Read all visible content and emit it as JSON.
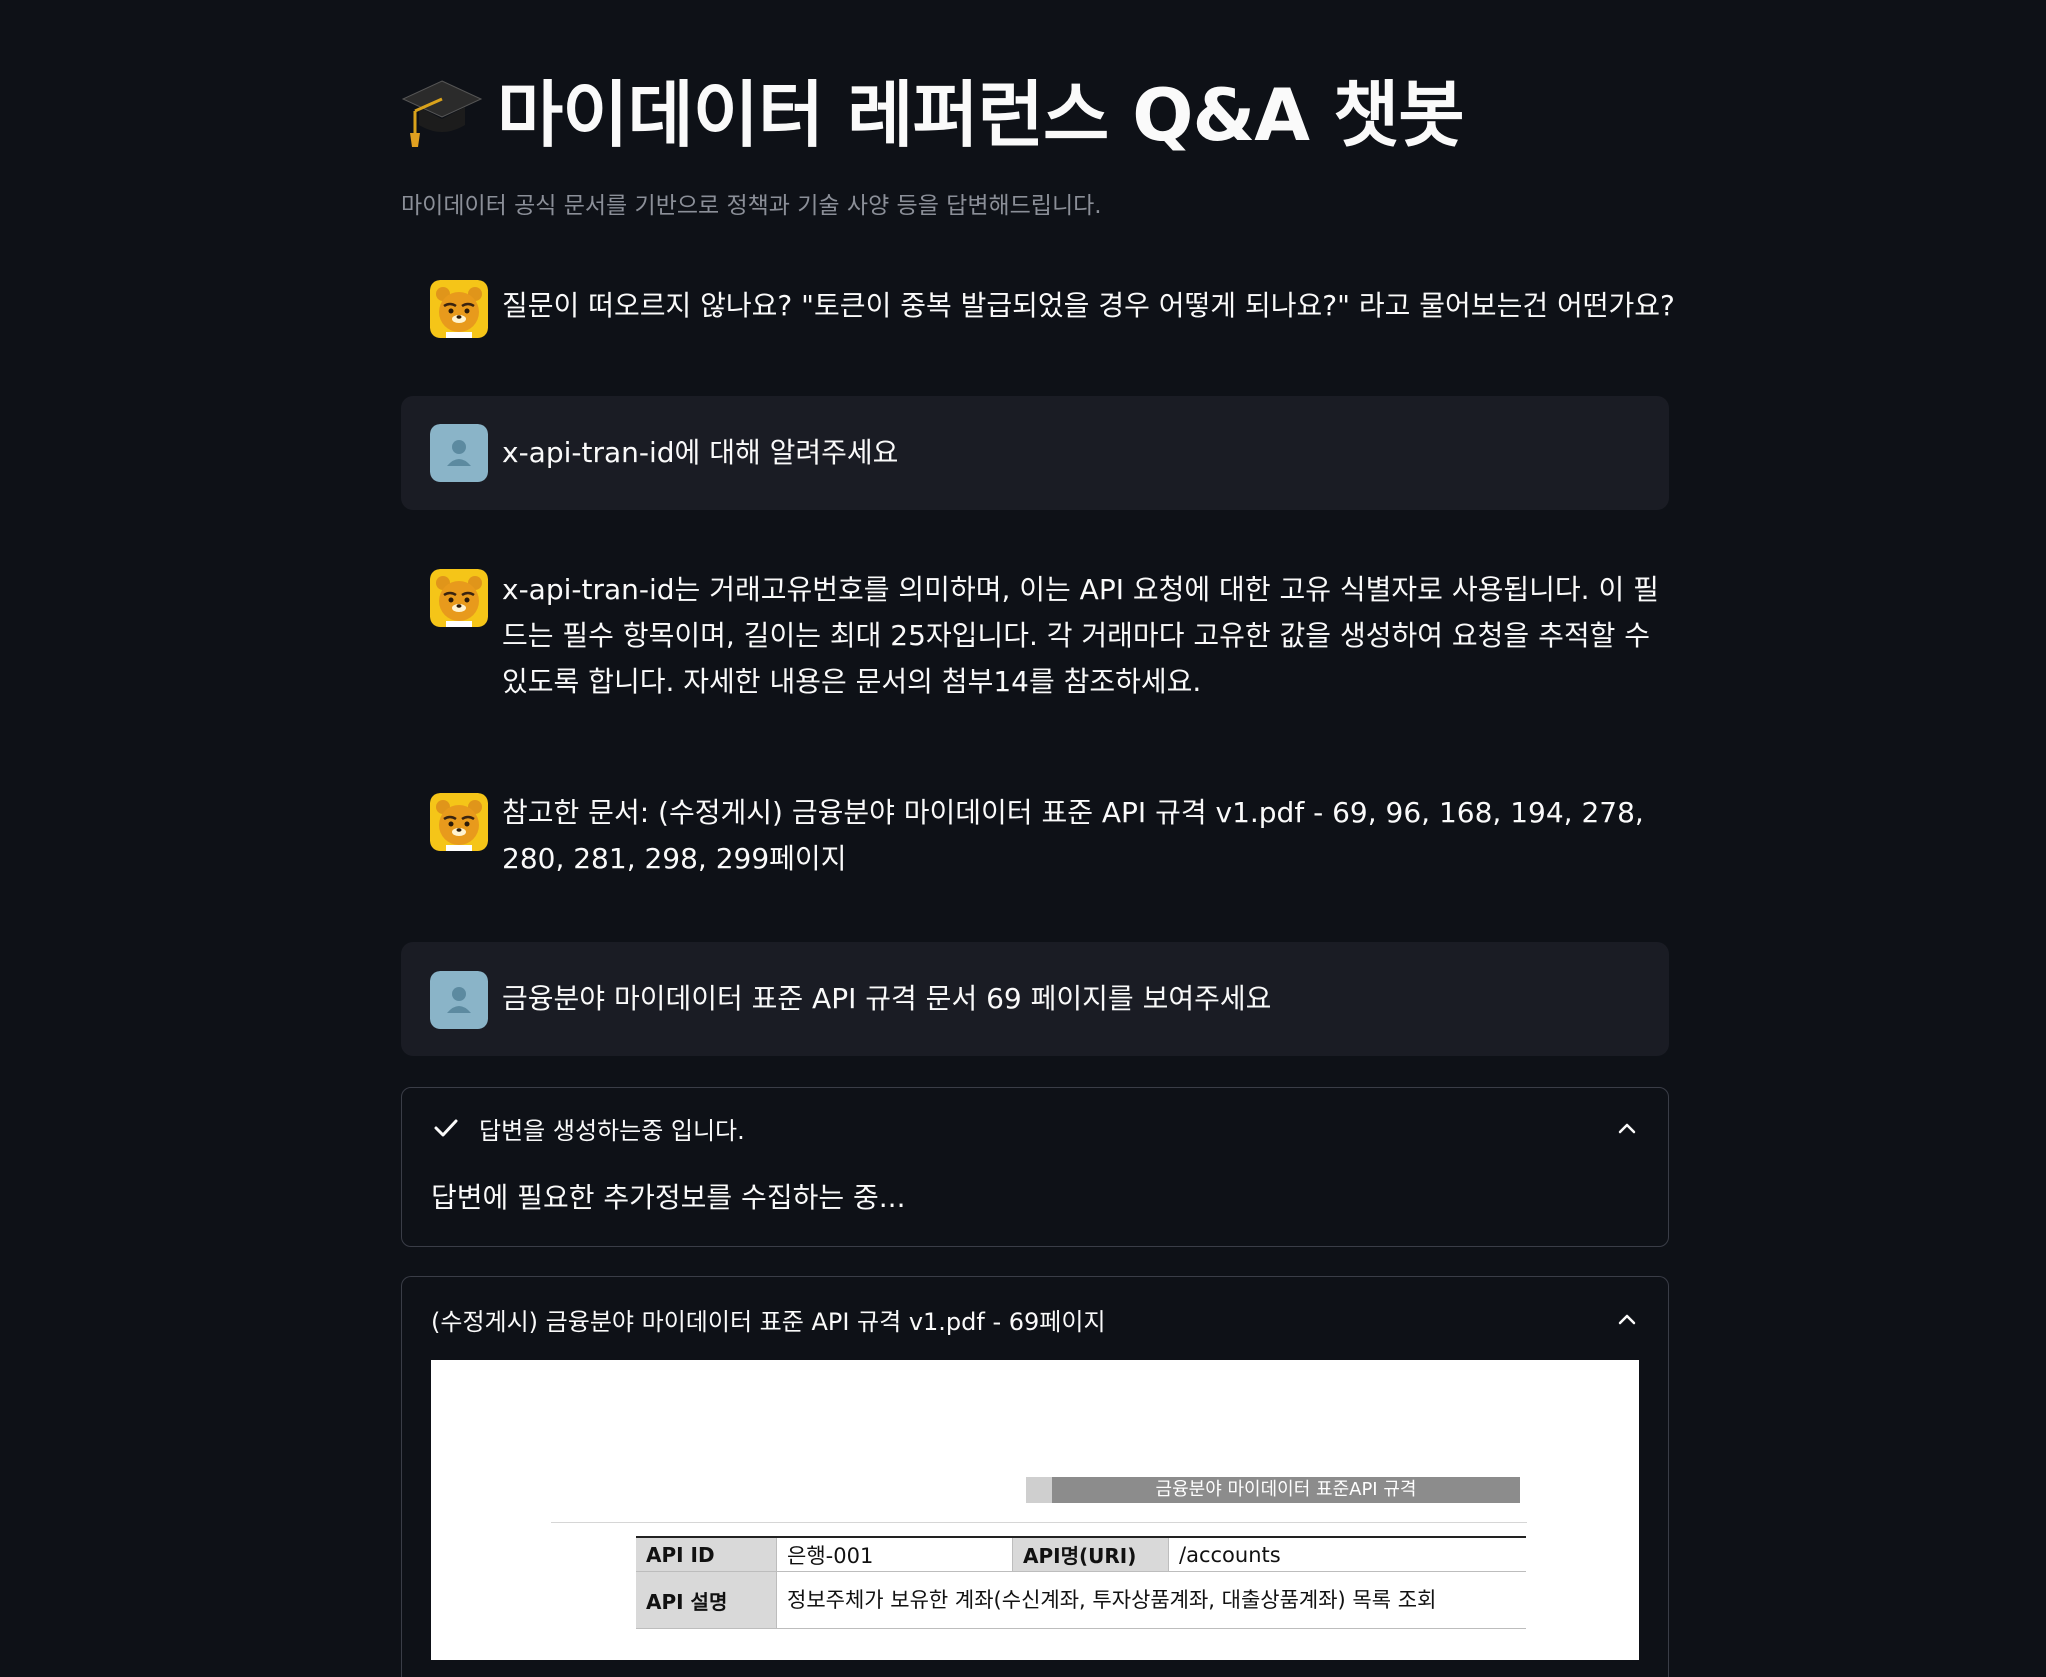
{
  "header": {
    "title": "마이데이터 레퍼런스 Q&A 챗봇",
    "subtitle": "마이데이터 공식 문서를 기반으로 정책과 기술 사양 등을 답변해드립니다."
  },
  "messages": [
    {
      "role": "assistant",
      "text": "질문이 떠오르지 않나요? \"토큰이 중복 발급되었을 경우 어떻게 되나요?\" 라고 물어보는건 어떤가요?"
    },
    {
      "role": "user",
      "text": "x-api-tran-id에 대해 알려주세요"
    },
    {
      "role": "assistant",
      "text": "x-api-tran-id는 거래고유번호를 의미하며, 이는 API 요청에 대한 고유 식별자로 사용됩니다. 이 필드는 필수 항목이며, 길이는 최대 25자입니다. 각 거래마다 고유한 값을 생성하여 요청을 추적할 수 있도록 합니다. 자세한 내용은 문서의 첨부14를 참조하세요."
    },
    {
      "role": "assistant",
      "text": "참고한 문서: (수정게시) 금융분야 마이데이터 표준 API 규격 v1.pdf - 69, 96, 168, 194, 278, 280, 281, 298, 299페이지"
    },
    {
      "role": "user",
      "text": "금융분야 마이데이터 표준 API 규격 문서 69 페이지를 보여주세요"
    }
  ],
  "status_expander": {
    "label": "답변을 생성하는중 입니다.",
    "body": "답변에 필요한 추가정보를 수집하는 중..."
  },
  "doc_expander": {
    "label": "(수정게시) 금융분야 마이데이터 표준 API 규격 v1.pdf - 69페이지",
    "page": {
      "header_band": "금융분야 마이데이터 표준API 규격",
      "rows": [
        {
          "h1": "API ID",
          "v1": "은행-001",
          "h2": "API명(URI)",
          "v2": "/accounts"
        },
        {
          "h1": "API 설명",
          "v1": "정보주체가 보유한 계좌(수신계좌, 투자상품계좌, 대출상품계좌) 목록 조회"
        }
      ]
    }
  },
  "colors": {
    "background": "#0e1117",
    "user_bubble": "#1a1c24",
    "assistant_avatar": "#f5c518",
    "user_avatar": "#8ab4c8",
    "text": "#fafafa",
    "muted": "#8b8f98"
  },
  "icons": {
    "title": "graduation-cap-icon",
    "assistant_avatar": "ryan-bear-avatar",
    "user_avatar": "person-icon",
    "status": "check-icon",
    "collapse": "chevron-up-icon"
  }
}
